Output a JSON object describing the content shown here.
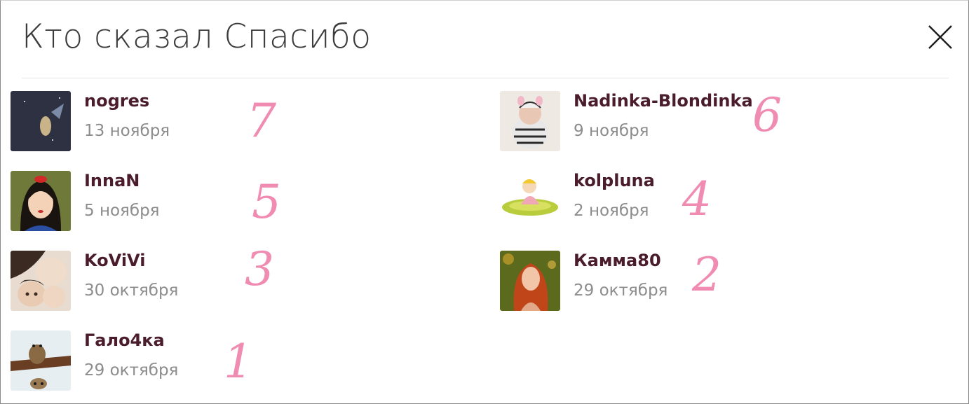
{
  "dialog": {
    "title": "Кто сказал Спасибо"
  },
  "users": [
    {
      "name": "nogres",
      "date": "13 ноября",
      "rank": "7"
    },
    {
      "name": "Nadinka-Blondinka",
      "date": "9 ноября",
      "rank": "6"
    },
    {
      "name": "InnaN",
      "date": "5 ноября",
      "rank": "5"
    },
    {
      "name": "kolpluna",
      "date": "2 ноября",
      "rank": "4"
    },
    {
      "name": "KoViVi",
      "date": "30 октября",
      "rank": "3"
    },
    {
      "name": "Камма80",
      "date": "29 октября",
      "rank": "2"
    },
    {
      "name": "Гало4ка",
      "date": "29 октября",
      "rank": "1"
    }
  ],
  "colors": {
    "name": "#4a1c2c",
    "date": "#8c8c8c",
    "annotation": "#f08cb2",
    "title": "#3c3c3c"
  },
  "icons": {
    "close": "close-icon"
  }
}
